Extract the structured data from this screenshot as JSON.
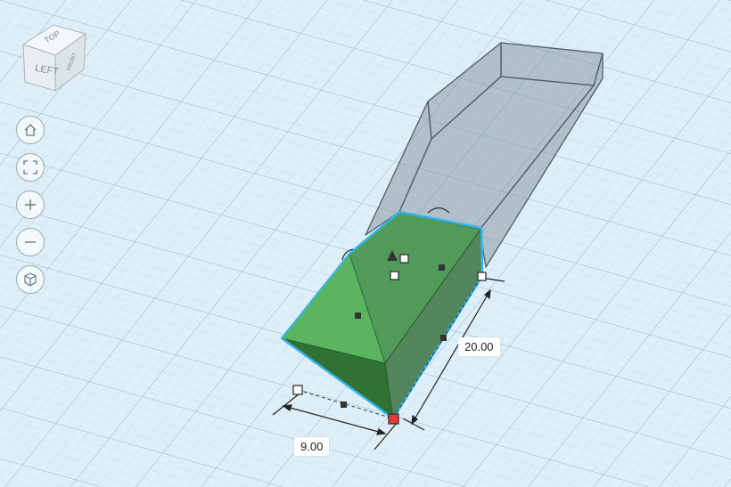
{
  "view_cube": {
    "top_face": "TOP",
    "left_face": "LEFT",
    "front_face": "FRONT"
  },
  "nav_controls": [
    {
      "name": "home-view",
      "icon": "home-icon"
    },
    {
      "name": "fit-view",
      "icon": "fit-frame-icon"
    },
    {
      "name": "zoom-in",
      "icon": "plus-icon"
    },
    {
      "name": "zoom-out",
      "icon": "minus-icon"
    },
    {
      "name": "perspective-toggle",
      "icon": "cube-perspective-icon"
    }
  ],
  "dimensions": {
    "length": "20.00",
    "width": "9.00"
  },
  "colors": {
    "grid_background": "#dfeff7",
    "shape_green": "#3f8f45",
    "shape_green_light": "#5bb560",
    "selection_outline": "#2fb4e9",
    "ghost_shape": "#7d8891",
    "active_handle": "#e53935"
  }
}
